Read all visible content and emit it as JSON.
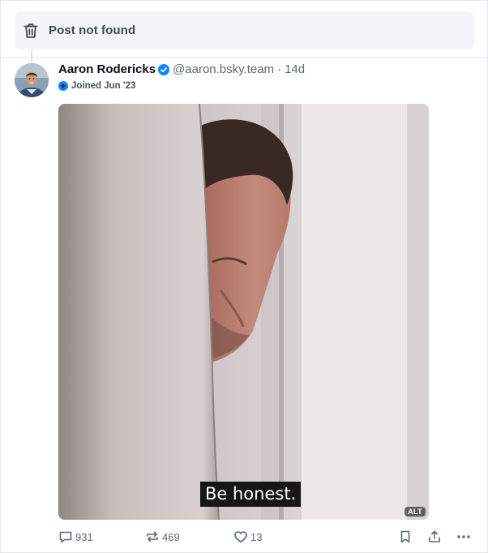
{
  "not_found": {
    "label": "Post not found",
    "icon": "trash-icon"
  },
  "post": {
    "author": {
      "display_name": "Aaron Rodericks",
      "handle": "@aaron.bsky.team",
      "verified": true,
      "avatar": "avatar"
    },
    "separator": "·",
    "timestamp": "14d",
    "joined": "Joined Jun '23",
    "media": {
      "subtitle": "Be honest.",
      "alt_badge": "ALT"
    },
    "stats": {
      "replies": "931",
      "reposts": "469",
      "likes": "13"
    }
  },
  "colors": {
    "accent": "#1083fe",
    "muted_text": "#5a6777",
    "banner_bg": "#f3f5f8"
  }
}
